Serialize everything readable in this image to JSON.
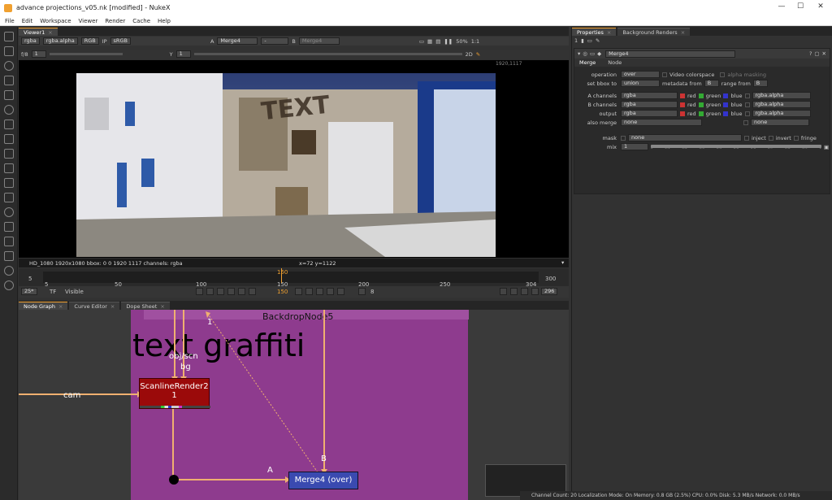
{
  "title_bar": {
    "title": "advance projections_v05.nk [modified] - NukeX"
  },
  "menu": [
    "File",
    "Edit",
    "Workspace",
    "Viewer",
    "Render",
    "Cache",
    "Help"
  ],
  "viewer": {
    "tab": "Viewer1",
    "channels": "rgba",
    "alpha": "rgba.alpha",
    "rgb": "RGB",
    "ip": "IP",
    "colorspace": "sRGB",
    "a_input": "Merge4",
    "b_input": "Merge4",
    "a_label": "A",
    "b_label": "B",
    "minus": "-",
    "zoom": "50%",
    "ratio": "1:1",
    "fstop": "f/8",
    "frame_one": "1",
    "y_label": "Y",
    "y_val": "1",
    "view_mode": "2D",
    "format_corner": "1920,1117",
    "image_text": "TEXT",
    "info_left": "HD_1080 1920x1080  bbox: 0 0 1920 1117 channels: rgba",
    "info_coords": "x=72 y=1122"
  },
  "timeline": {
    "ticks": [
      "5",
      "50",
      "100",
      "150",
      "200",
      "250",
      "304"
    ],
    "playhead": "150",
    "start": "5",
    "end": "300",
    "frame_field": "150",
    "step": "8",
    "end_field": "296",
    "fps": "25*",
    "tf": "TF",
    "visible": "Visible"
  },
  "node_graph": {
    "tabs": [
      "Node Graph",
      "Curve Editor",
      "Dope Sheet"
    ],
    "backdrop": "BackdropNode5",
    "graffiti": "text graffiti",
    "scanline": "ScanlineRender2",
    "scanline_sub": "1",
    "merge": "Merge4 (over)",
    "cam": "cam",
    "obj": "obj/scn",
    "bg": "bg",
    "a": "A",
    "b": "B",
    "one": "1"
  },
  "properties": {
    "tabs": [
      "Properties",
      "Background Renders"
    ],
    "count": "1",
    "node_name": "Merge4",
    "sub_tabs": [
      "Merge",
      "Node"
    ],
    "operation_label": "operation",
    "operation": "over",
    "video_cs": "Video colorspace",
    "alpha_masking": "alpha masking",
    "bbox_label": "set bbox to",
    "bbox": "union",
    "metadata_label": "metadata from",
    "metadata": "B",
    "range_label": "range from",
    "range": "B",
    "a_channels_label": "A channels",
    "b_channels_label": "B channels",
    "output_label": "output",
    "channels": "rgba",
    "alpha": "rgba.alpha",
    "red": "red",
    "green": "green",
    "blue": "blue",
    "also_merge_label": "also merge",
    "none": "none",
    "mask_label": "mask",
    "inject": "inject",
    "invert": "invert",
    "fringe": "fringe",
    "mix_label": "mix",
    "mix": "1",
    "mix_ticks": [
      "0",
      "0.1",
      "0.2",
      "0.3",
      "0.4",
      "0.5",
      "0.6",
      "0.7",
      "0.8",
      "0.9",
      "1"
    ]
  },
  "status": "Channel Count: 20  Localization Mode: On  Memory: 0.8 GB (2.5%)  CPU: 0.0%  Disk: 5.3 MB/s  Network: 0.0 MB/s"
}
